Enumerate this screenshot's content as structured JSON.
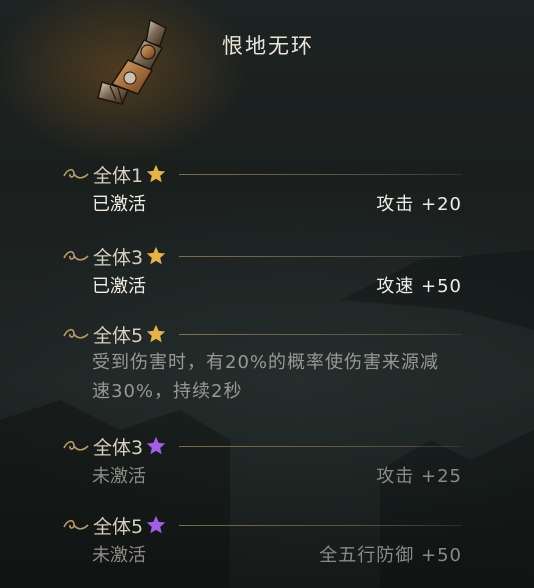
{
  "item": {
    "title": "恨地无环",
    "icon": "gauntlet-icon"
  },
  "colors": {
    "star_gold": "#e6b24a",
    "star_purple": "#a35ee8",
    "active_text": "#f2ede4",
    "inactive_text": "#8c8a85"
  },
  "set_bonuses": [
    {
      "label": "全体1",
      "star": "gold",
      "status": "已激活",
      "bonus": "攻击  +20"
    },
    {
      "label": "全体3",
      "star": "gold",
      "status": "已激活",
      "bonus": "攻速  +50"
    },
    {
      "label": "全体5",
      "star": "gold",
      "description": "受到伤害时，有20%的概率使伤害来源减速30%，持续2秒"
    },
    {
      "label": "全体3",
      "star": "purple",
      "status": "未激活",
      "bonus": "攻击  +25"
    },
    {
      "label": "全体5",
      "star": "purple",
      "status": "未激活",
      "bonus": "全五行防御  +50"
    }
  ]
}
